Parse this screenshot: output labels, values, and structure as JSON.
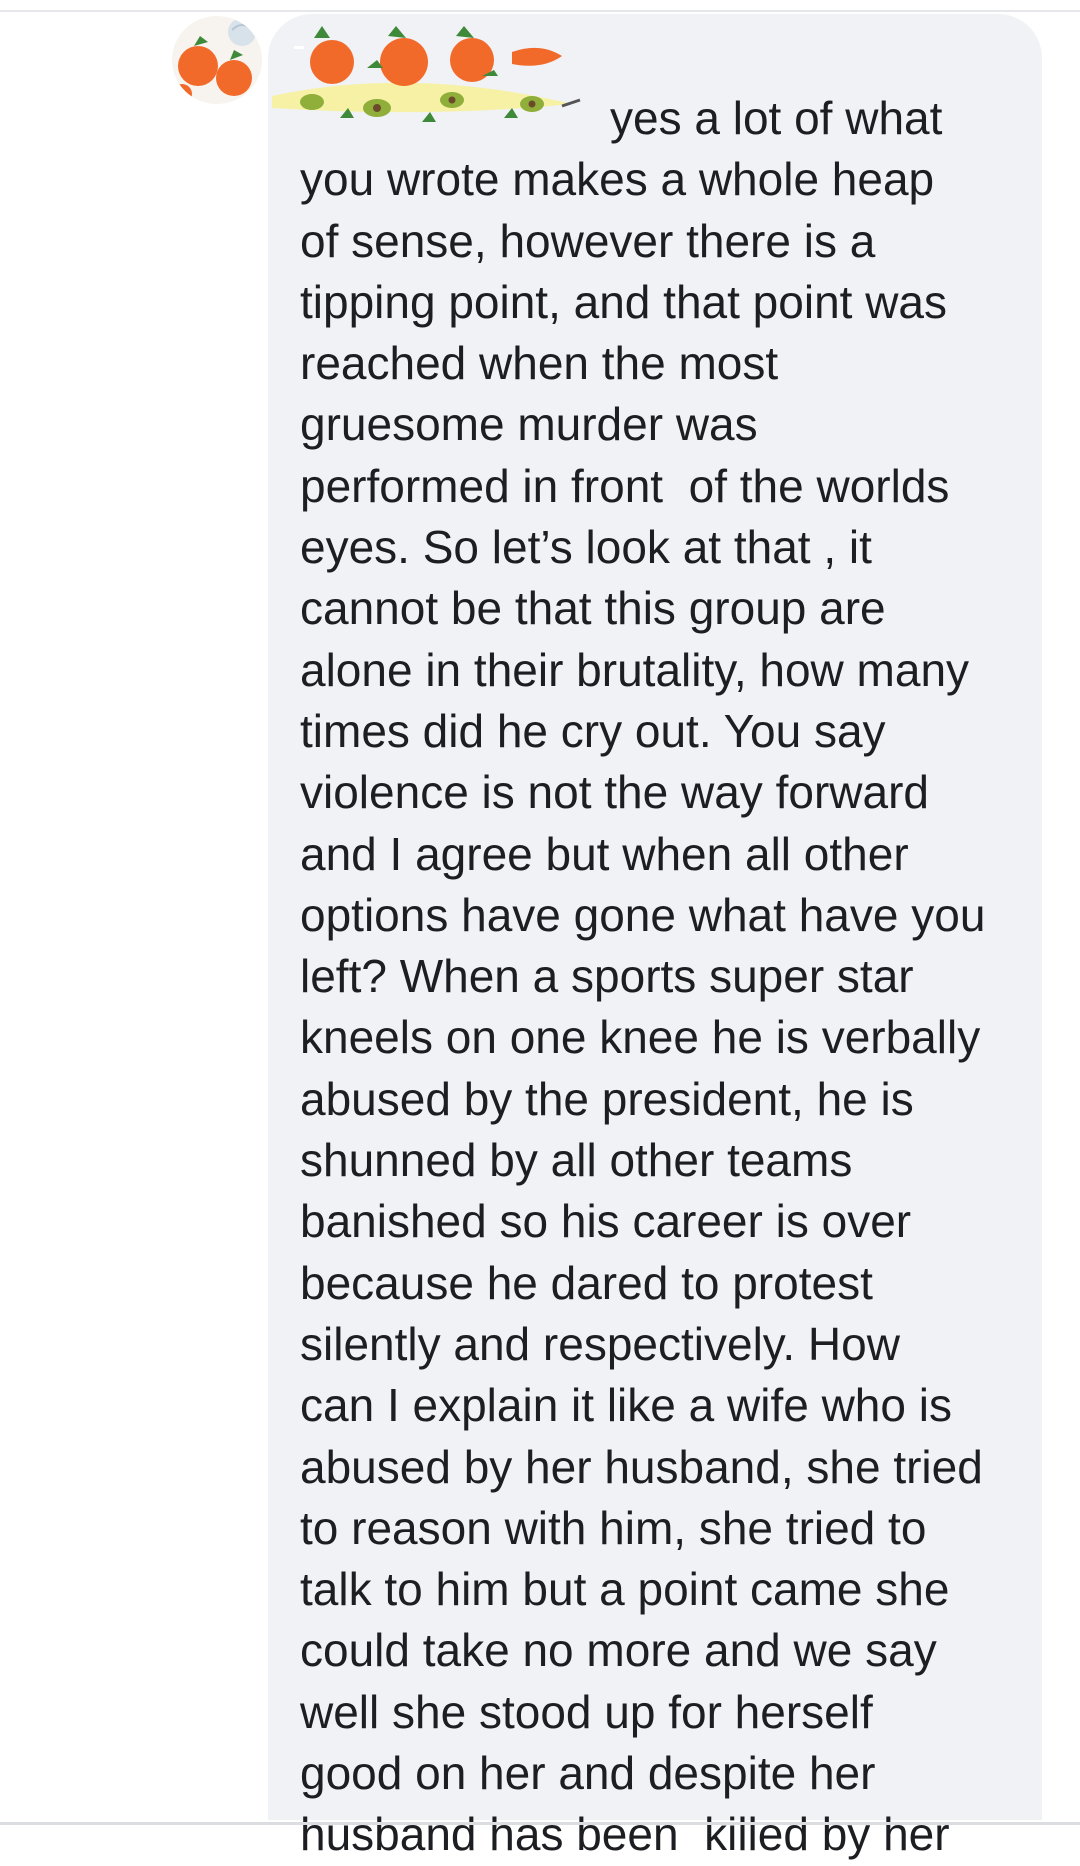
{
  "comment": {
    "text": "yes a lot of what\nyou wrote makes a whole heap\nof sense, however there is a\ntipping point, and that point was\nreached when the most\ngruesome murder was\nperformed in front  of the worlds\neyes. So let’s look at that , it\ncannot be that this group are\nalone in their brutality, how many\ntimes did he cry out. You say\nviolence is not the way forward\nand I agree but when all other\noptions have gone what have you\nleft? When a sports super star\nkneels on one knee he is verbally\nabused by the president, he is\nshunned by all other teams\nbanished so his career is over\nbecause he dared to protest\nsilently and respectively. How\ncan I explain it like a wife who is\nabused by her husband, she tried\nto reason with him, she tried to\ntalk to him but a point came she\ncould take no more and we say\nwell she stood up for herself\ngood on her and despite her\nhusband has been  killed by her"
  },
  "avatar": {
    "icon": "orange-avatar-icon"
  },
  "author": {
    "icon": "fruit-sticker-name-redaction"
  },
  "colors": {
    "bubble": "#f0f2f5",
    "text": "#1c1e21",
    "orange": "#f26a2a",
    "avocado": "#8fae3a",
    "highlight": "#f7f1a6"
  }
}
